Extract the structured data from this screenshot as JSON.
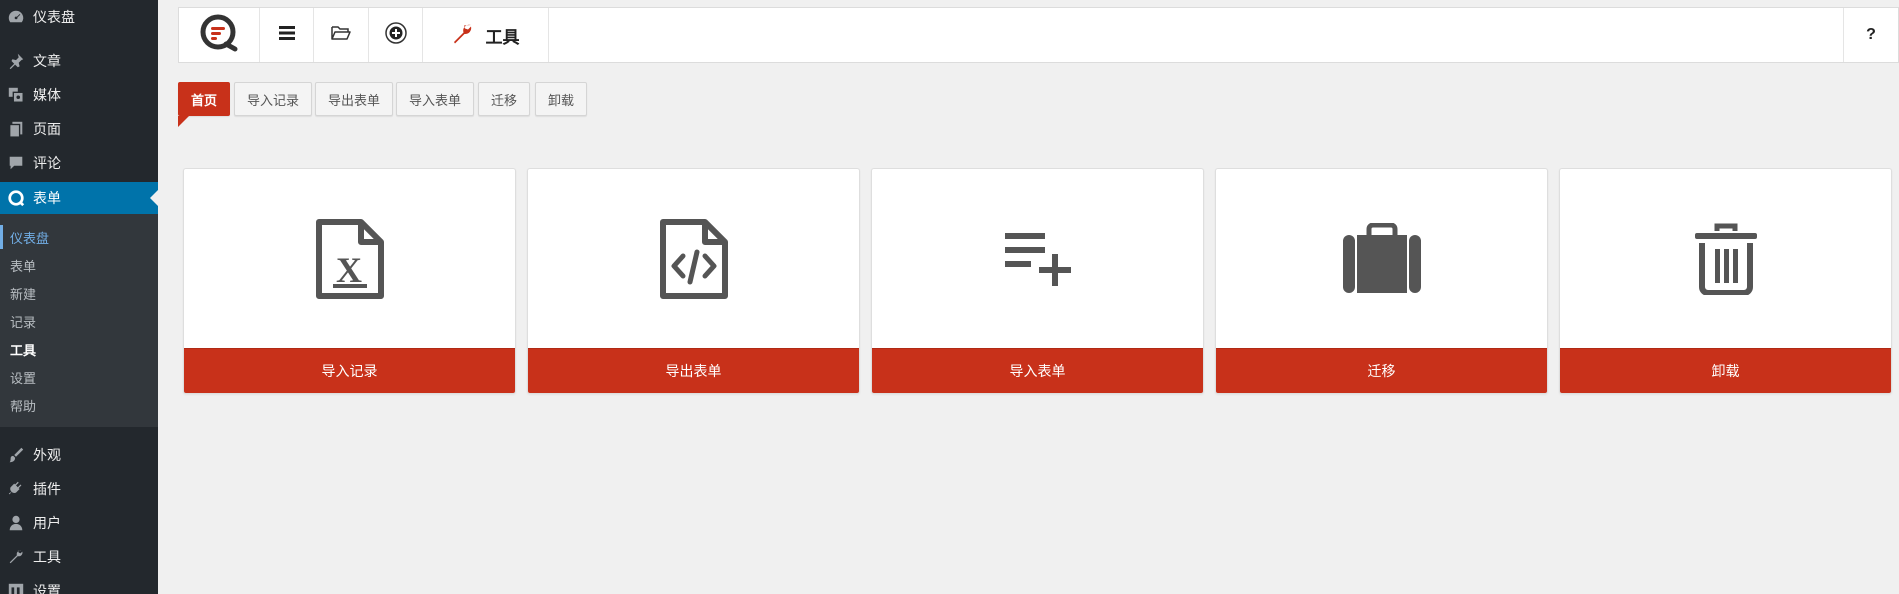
{
  "sidebar": {
    "items": [
      {
        "label": "仪表盘",
        "icon": "dashboard-icon"
      },
      {
        "label": "文章",
        "icon": "pin-icon"
      },
      {
        "label": "媒体",
        "icon": "media-icon"
      },
      {
        "label": "页面",
        "icon": "page-icon"
      },
      {
        "label": "评论",
        "icon": "comment-icon"
      },
      {
        "label": "表单",
        "icon": "forms-logo-icon"
      },
      {
        "label": "外观",
        "icon": "paintbrush-icon"
      },
      {
        "label": "插件",
        "icon": "plugin-icon"
      },
      {
        "label": "用户",
        "icon": "user-icon"
      },
      {
        "label": "工具",
        "icon": "wrench-icon"
      },
      {
        "label": "设置",
        "icon": "settings-icon"
      }
    ],
    "submenu": [
      "仪表盘",
      "表单",
      "新建",
      "记录",
      "工具",
      "设置",
      "帮助"
    ]
  },
  "toolbar": {
    "title": "工具",
    "help": "?",
    "icons": [
      "quform-logo-icon",
      "menu-icon",
      "folder-open-icon",
      "plus-circle-icon",
      "wrench-icon"
    ]
  },
  "tabs": [
    "首页",
    "导入记录",
    "导出表单",
    "导入表单",
    "迁移",
    "卸载"
  ],
  "cards": [
    {
      "label": "导入记录",
      "icon": "excel-file-icon"
    },
    {
      "label": "导出表单",
      "icon": "code-file-icon"
    },
    {
      "label": "导入表单",
      "icon": "playlist-add-icon"
    },
    {
      "label": "迁移",
      "icon": "briefcase-icon"
    },
    {
      "label": "卸载",
      "icon": "trash-icon"
    }
  ],
  "colors": {
    "accent": "#c8311a",
    "sidebar": "#23282d",
    "sidebar_active": "#0073aa",
    "icon_gray": "#555555"
  }
}
